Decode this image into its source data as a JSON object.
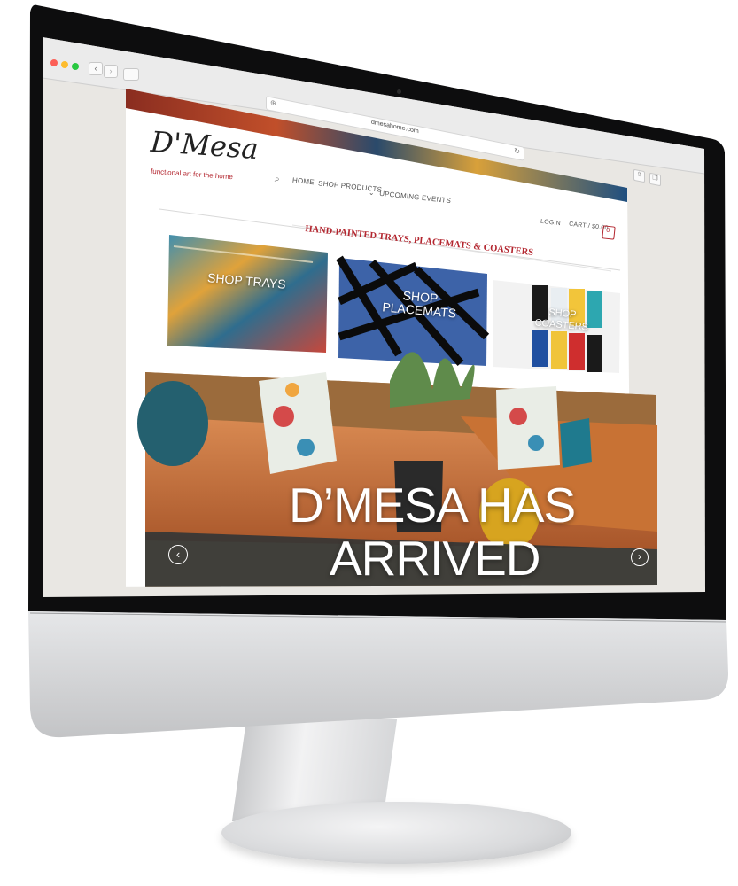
{
  "browser": {
    "url": "dmesahome.com"
  },
  "site": {
    "logo_text": "D'Mesa",
    "tagline": "functional art for the home",
    "nav": {
      "home": "HOME",
      "shop_products": "SHOP PRODUCTS",
      "upcoming_events": "UPCOMING EVENTS"
    },
    "account": {
      "login": "LOGIN",
      "cart": "CART / $0.00",
      "cart_count": "0"
    },
    "banner_heading": "HAND-PAINTED TRAYS, PLACEMATS & COASTERS",
    "tiles": [
      {
        "label_line1": "SHOP TRAYS",
        "label_line2": ""
      },
      {
        "label_line1": "SHOP",
        "label_line2": "PLACEMATS"
      },
      {
        "label_line1": "SHOP",
        "label_line2": "COASTERS"
      }
    ],
    "hero": {
      "line1": "D’MESA HAS",
      "line2": "ARRIVED"
    }
  },
  "colors": {
    "brand_red": "#b3262f",
    "frame_black": "#111111",
    "chin_silver": "#d4d5d7",
    "sofa_orange": "#c8703c"
  },
  "icons": {
    "search": "magnifier",
    "cart": "shopping-bag",
    "prev": "chevron-left-circle",
    "next": "chevron-right-circle",
    "reload": "reload",
    "share": "share",
    "tabs": "tabs"
  }
}
